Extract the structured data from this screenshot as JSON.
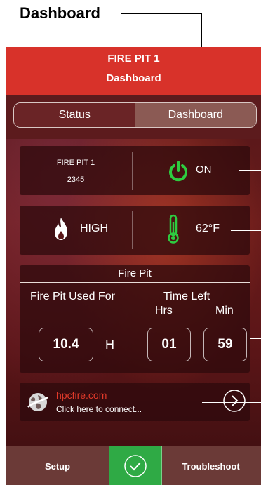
{
  "callout": {
    "label": "Dashboard"
  },
  "header": {
    "line1": "FIRE PIT 1",
    "line2": "Dashboard"
  },
  "tabs": {
    "status": "Status",
    "dashboard": "Dashboard"
  },
  "device": {
    "name": "FIRE PIT 1",
    "id": "2345",
    "power_state": "ON",
    "power_icon": "power-icon",
    "power_color": "#2ecc40"
  },
  "flame": {
    "level": "HIGH",
    "temperature": "62°F",
    "thermo_color": "#2ecc40"
  },
  "firepit": {
    "title": "Fire Pit",
    "used_label": "Fire Pit Used For",
    "used_value": "10.4",
    "used_unit": "H",
    "time_left_label": "Time Left",
    "hrs_label": "Hrs",
    "min_label": "Min",
    "hrs_value": "01",
    "min_value": "59"
  },
  "link": {
    "site": "hpcfire.com",
    "subtitle": "Click here to connect..."
  },
  "bottom_nav": {
    "setup": "Setup",
    "troubleshoot": "Troubleshoot"
  },
  "colors": {
    "header_red": "#d8322a",
    "accent_green": "#2faa45",
    "link_red": "#e23a2a"
  }
}
